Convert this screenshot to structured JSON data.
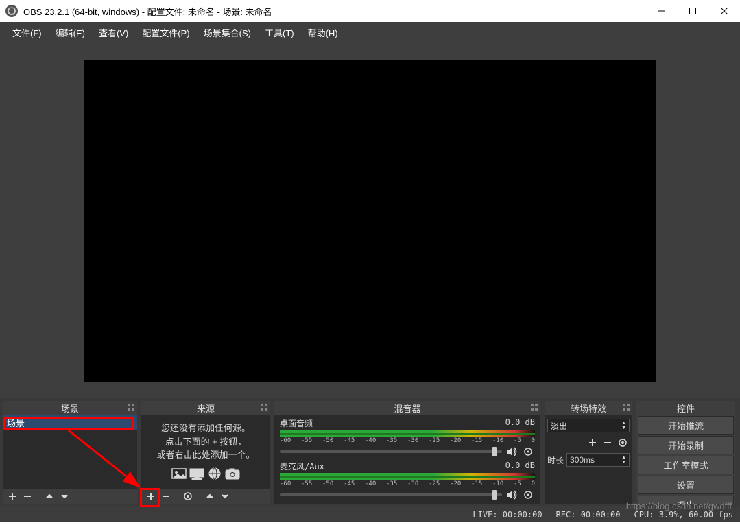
{
  "titlebar": {
    "title": "OBS 23.2.1 (64-bit, windows) - 配置文件: 未命名 - 场景: 未命名"
  },
  "menubar": [
    "文件(F)",
    "编辑(E)",
    "查看(V)",
    "配置文件(P)",
    "场景集合(S)",
    "工具(T)",
    "帮助(H)"
  ],
  "scenes": {
    "title": "场景",
    "items": [
      "场景"
    ]
  },
  "sources": {
    "title": "来源",
    "empty1": "您还没有添加任何源。",
    "empty2": "点击下面的 + 按钮，",
    "empty3": "或者右击此处添加一个。"
  },
  "mixer": {
    "title": "混音器",
    "ticks": [
      "-60",
      "-55",
      "-50",
      "-45",
      "-40",
      "-35",
      "-30",
      "-25",
      "-20",
      "-15",
      "-10",
      "-5",
      "0"
    ],
    "channels": [
      {
        "name": "桌面音频",
        "db": "0.0 dB"
      },
      {
        "name": "麦克风/Aux",
        "db": "0.0 dB"
      }
    ]
  },
  "transitions": {
    "title": "转场特效",
    "selected": "淡出",
    "duration_label": "时长",
    "duration_value": "300ms"
  },
  "controls": {
    "title": "控件",
    "buttons": [
      "开始推流",
      "开始录制",
      "工作室模式",
      "设置",
      "退出"
    ]
  },
  "statusbar": {
    "live": "LIVE: 00:00:00",
    "rec": "REC: 00:00:00",
    "cpu": "CPU: 3.9%, 60.00 fps"
  },
  "watermark": "https://blog.csdn.net/gwdfff"
}
